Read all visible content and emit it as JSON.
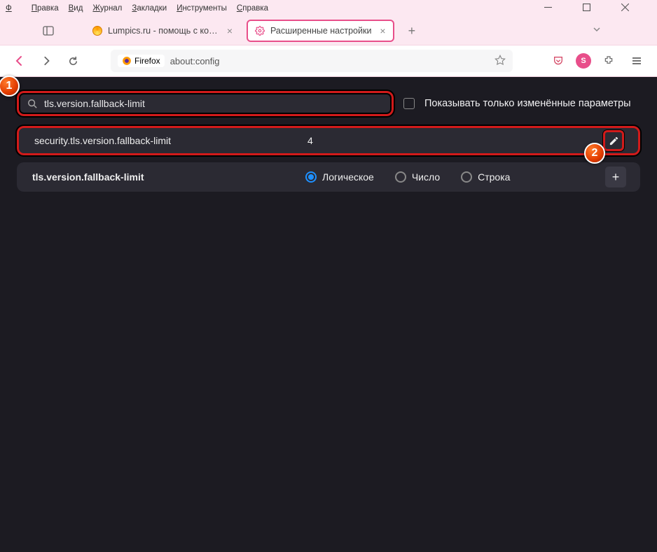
{
  "menu": {
    "file": "Файл",
    "edit": "Правка",
    "view": "Вид",
    "history": "Журнал",
    "bookmarks": "Закладки",
    "tools": "Инструменты",
    "help": "Справка"
  },
  "tabs": {
    "tab1": {
      "title": "Lumpics.ru - помощь с компью"
    },
    "tab2": {
      "title": "Расширенные настройки"
    }
  },
  "urlbar": {
    "prefix": "Firefox",
    "address": "about:config"
  },
  "search": {
    "value": "tls.version.fallback-limit",
    "show_modified_label": "Показывать только изменённые параметры"
  },
  "result": {
    "name": "security.tls.version.fallback-limit",
    "value": "4"
  },
  "new_pref": {
    "name": "tls.version.fallback-limit",
    "type_boolean": "Логическое",
    "type_number": "Число",
    "type_string": "Строка"
  },
  "callouts": {
    "one": "1",
    "two": "2"
  },
  "toolbar": {
    "badge": "S"
  }
}
